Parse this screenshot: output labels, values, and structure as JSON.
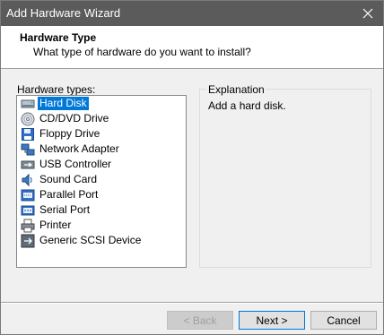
{
  "window": {
    "title": "Add Hardware Wizard"
  },
  "header": {
    "title": "Hardware Type",
    "subtitle": "What type of hardware do you want to install?"
  },
  "hardware_list": {
    "label": "Hardware types:",
    "items": [
      {
        "label": "Hard Disk",
        "icon": "hard-disk-icon",
        "selected": true
      },
      {
        "label": "CD/DVD Drive",
        "icon": "cd-dvd-icon",
        "selected": false
      },
      {
        "label": "Floppy Drive",
        "icon": "floppy-icon",
        "selected": false
      },
      {
        "label": "Network Adapter",
        "icon": "network-adapter-icon",
        "selected": false
      },
      {
        "label": "USB Controller",
        "icon": "usb-icon",
        "selected": false
      },
      {
        "label": "Sound Card",
        "icon": "sound-card-icon",
        "selected": false
      },
      {
        "label": "Parallel Port",
        "icon": "parallel-port-icon",
        "selected": false
      },
      {
        "label": "Serial Port",
        "icon": "serial-port-icon",
        "selected": false
      },
      {
        "label": "Printer",
        "icon": "printer-icon",
        "selected": false
      },
      {
        "label": "Generic SCSI Device",
        "icon": "scsi-icon",
        "selected": false
      }
    ]
  },
  "explanation": {
    "title": "Explanation",
    "text": "Add a hard disk."
  },
  "buttons": {
    "back": "< Back",
    "next": "Next >",
    "cancel": "Cancel"
  },
  "colors": {
    "titlebar": "#5b5b5b",
    "selection": "#0078d7",
    "background": "#f0f0f0"
  }
}
